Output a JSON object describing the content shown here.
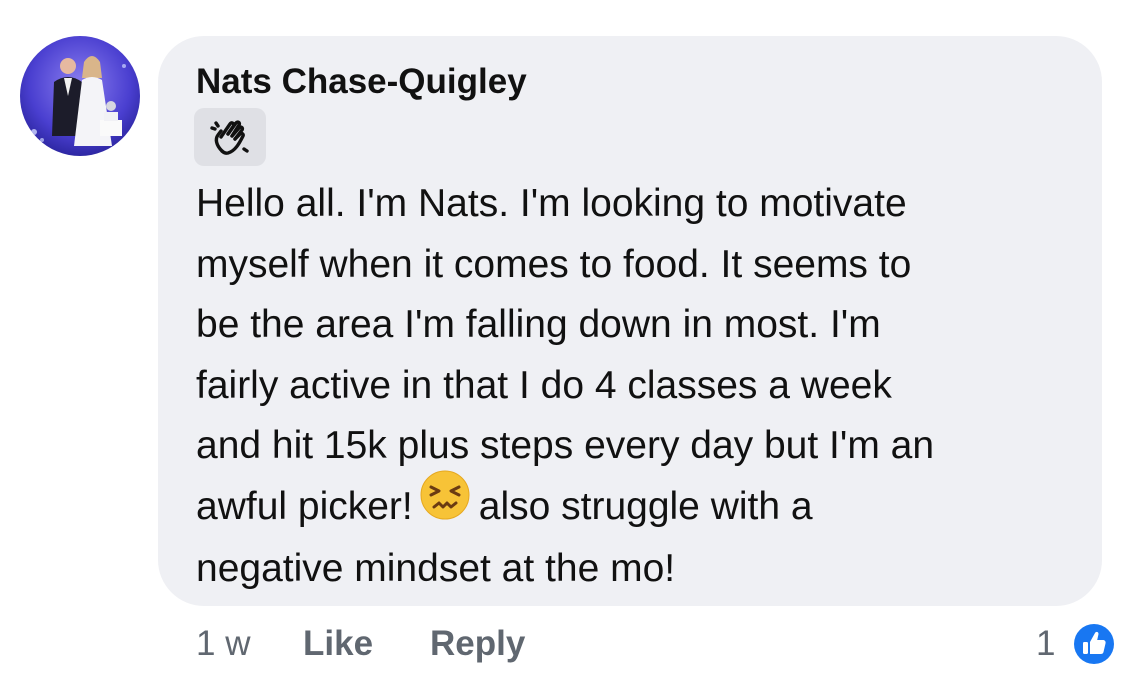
{
  "comment": {
    "author": "Nats Chase-Quigley",
    "badge_icon": "waving-hand-icon",
    "lines": [
      "Hello all. I'm Nats. I'm looking to motivate",
      "myself when it comes to food. It seems to",
      "be the area I'm falling down in most. I'm",
      "fairly active in that I do 4 classes a week",
      "and hit 15k plus steps every day but I'm an"
    ],
    "line6_before_emoji": "awful picker!",
    "emoji": "confounded-face-icon",
    "line6_after_emoji": "also struggle with a",
    "line7": "negative mindset at the mo!"
  },
  "footer": {
    "timestamp": "1 w",
    "like_label": "Like",
    "reply_label": "Reply",
    "reaction_count": "1",
    "reaction_icon": "thumbs-up-icon"
  },
  "colors": {
    "bubble": "#eff0f4",
    "accent": "#1877f2",
    "text": "#111111",
    "secondary_text": "#606770"
  }
}
